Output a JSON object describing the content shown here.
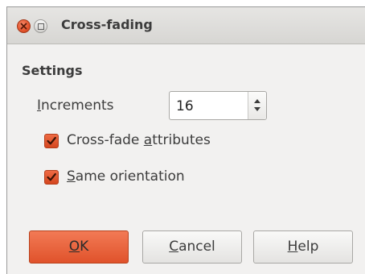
{
  "window": {
    "title": "Cross-fading"
  },
  "settings": {
    "section_title": "Settings",
    "increments_label_prefix": "I",
    "increments_label_rest": "ncrements",
    "increments_value": "16",
    "options": [
      {
        "pre": "Cross-fade ",
        "mnemonic": "a",
        "post": "ttributes",
        "checked": true
      },
      {
        "pre": "",
        "mnemonic": "S",
        "post": "ame orientation",
        "checked": true
      }
    ]
  },
  "buttons": {
    "ok": {
      "mnemonic": "O",
      "rest": "K"
    },
    "cancel": {
      "mnemonic": "C",
      "rest": "ancel"
    },
    "help": {
      "mnemonic": "H",
      "rest": "elp"
    }
  },
  "colors": {
    "accent": "#e0522b",
    "window_bg": "#f2f1f0",
    "text": "#3c3c3c"
  },
  "icons": {
    "close": "close-icon",
    "maximize": "maximize-icon",
    "check": "checkmark-icon",
    "spin_up": "arrow-up-icon",
    "spin_down": "arrow-down-icon"
  }
}
